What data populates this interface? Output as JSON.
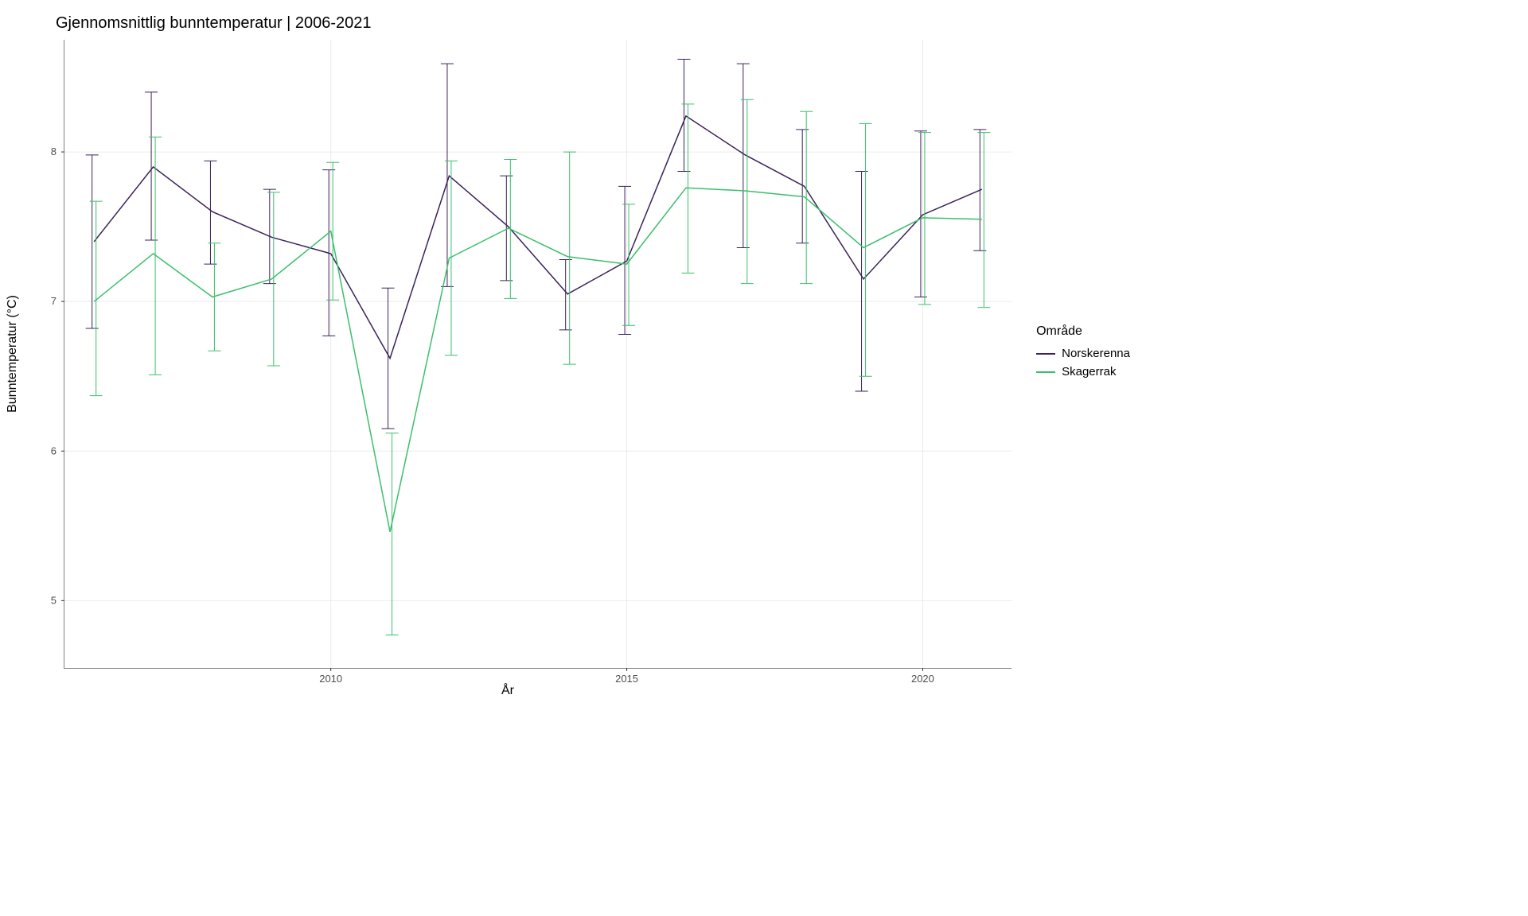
{
  "title": "Gjennomsnittlig bunntemperatur | 2006-2021",
  "xlabel": "År",
  "ylabel": "Bunntemperatur (°C)",
  "legend_title": "Område",
  "legend": [
    {
      "name": "Norskerenna",
      "color": "#3b2259"
    },
    {
      "name": "Skagerrak",
      "color": "#3cbf6b"
    }
  ],
  "x_ticks": [
    2010,
    2015,
    2020
  ],
  "y_ticks": [
    5,
    6,
    7,
    8
  ],
  "chart_data": {
    "type": "line",
    "xlabel": "År",
    "ylabel": "Bunntemperatur (°C)",
    "xlim": [
      2005.5,
      2021.5
    ],
    "ylim": [
      4.55,
      8.75
    ],
    "x": [
      2006,
      2007,
      2008,
      2009,
      2010,
      2011,
      2012,
      2013,
      2014,
      2015,
      2016,
      2017,
      2018,
      2019,
      2020,
      2021
    ],
    "series": [
      {
        "name": "Norskerenna",
        "color": "#3b2259",
        "values": [
          7.4,
          7.9,
          7.6,
          7.43,
          7.32,
          6.62,
          7.84,
          7.5,
          7.05,
          7.27,
          8.24,
          7.98,
          7.77,
          7.15,
          7.58,
          7.75
        ],
        "err_low": [
          6.82,
          7.41,
          7.25,
          7.12,
          6.77,
          6.15,
          7.1,
          7.14,
          6.81,
          6.78,
          7.87,
          7.36,
          7.39,
          6.4,
          7.03,
          7.34
        ],
        "err_high": [
          7.98,
          8.4,
          7.94,
          7.75,
          7.88,
          7.09,
          8.59,
          7.84,
          7.28,
          7.77,
          8.62,
          8.59,
          8.15,
          7.87,
          8.14,
          8.15
        ]
      },
      {
        "name": "Skagerrak",
        "color": "#3cbf6b",
        "values": [
          7.0,
          7.32,
          7.03,
          7.15,
          7.47,
          5.46,
          7.29,
          7.49,
          7.3,
          7.25,
          7.76,
          7.74,
          7.7,
          7.36,
          7.56,
          7.55
        ],
        "err_low": [
          6.37,
          6.51,
          6.67,
          6.57,
          7.01,
          4.77,
          6.64,
          7.02,
          6.58,
          6.84,
          7.19,
          7.12,
          7.12,
          6.5,
          6.98,
          6.96
        ],
        "err_high": [
          7.67,
          8.1,
          7.39,
          7.73,
          7.93,
          6.12,
          7.94,
          7.95,
          8.0,
          7.65,
          8.32,
          8.35,
          8.27,
          8.19,
          8.13,
          8.13
        ]
      }
    ]
  }
}
